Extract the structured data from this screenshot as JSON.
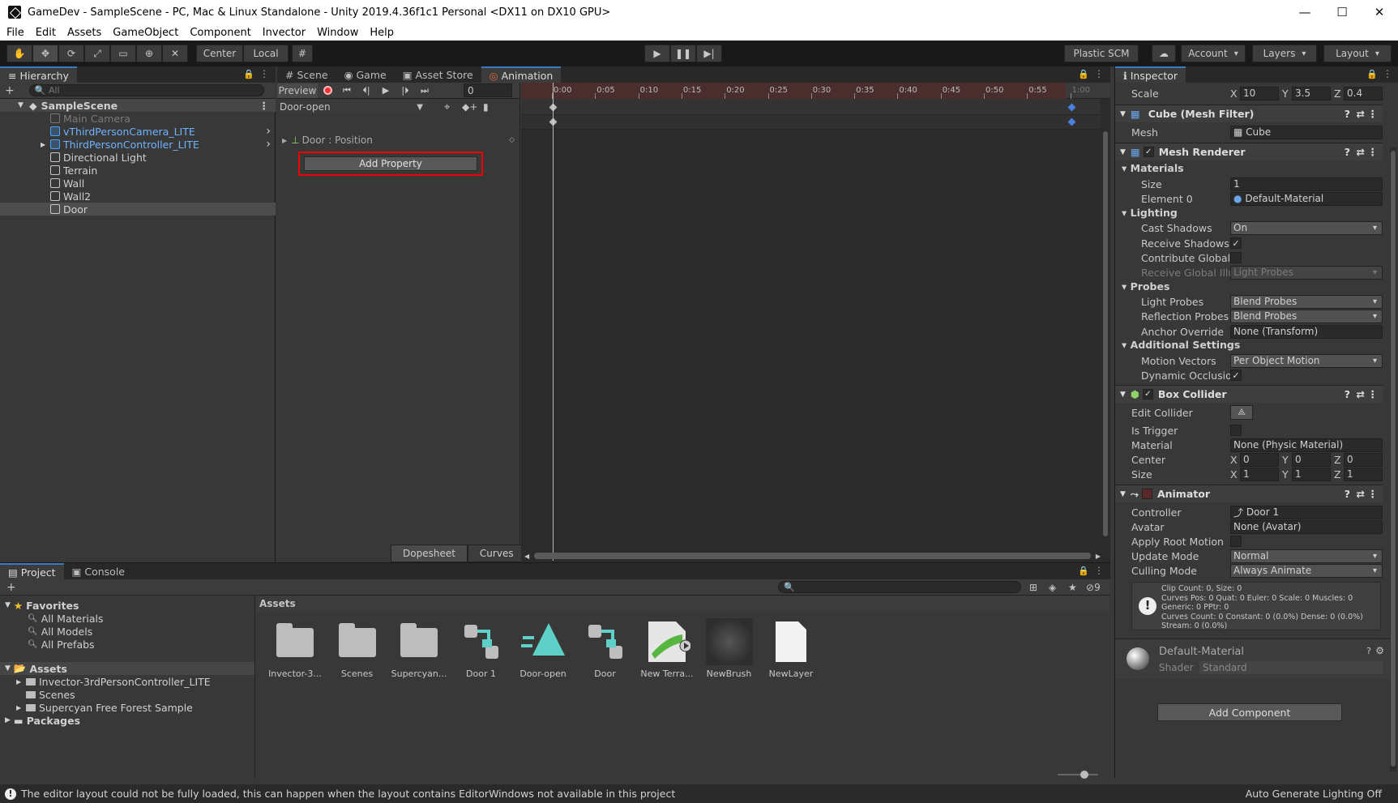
{
  "window": {
    "title": "GameDev - SampleScene - PC, Mac & Linux Standalone - Unity 2019.4.36f1c1 Personal <DX11 on DX10 GPU>",
    "minimize": "—",
    "maximize": "☐",
    "close": "✕"
  },
  "menu": [
    "File",
    "Edit",
    "Assets",
    "GameObject",
    "Component",
    "Invector",
    "Window",
    "Help"
  ],
  "toolbar": {
    "tools": [
      "✋",
      "✥",
      "⟳",
      "⤢",
      "▭",
      "⊕",
      "✕"
    ],
    "pivot": "Center",
    "space": "Local",
    "grid": "#",
    "play": "▶",
    "pause": "❚❚",
    "step": "▶|",
    "plastic": "Plastic SCM",
    "cloud": "☁",
    "account": "Account",
    "layers": "Layers",
    "layout": "Layout"
  },
  "hierarchy": {
    "tab": "Hierarchy",
    "add": "+",
    "search_placeholder": "All",
    "scene": "SampleScene",
    "items": [
      {
        "label": "Main Camera",
        "style": "disabled"
      },
      {
        "label": "vThirdPersonCamera_LITE",
        "style": "prefab"
      },
      {
        "label": "ThirdPersonController_LITE",
        "style": "prefab"
      },
      {
        "label": "Directional Light",
        "style": "normal"
      },
      {
        "label": "Terrain",
        "style": "normal"
      },
      {
        "label": "Wall",
        "style": "normal"
      },
      {
        "label": "Wall2",
        "style": "normal"
      },
      {
        "label": "Door",
        "style": "selected"
      }
    ]
  },
  "center_tabs": [
    "Scene",
    "Game",
    "Asset Store",
    "Animation"
  ],
  "animation": {
    "preview": "Preview",
    "frame": "0",
    "clip": "Door-open",
    "property": "Door : Position",
    "add_property": "Add Property",
    "ticks": [
      "0:00",
      "0:05",
      "0:10",
      "0:15",
      "0:20",
      "0:25",
      "0:30",
      "0:35",
      "0:40",
      "0:45",
      "0:50",
      "0:55",
      "1:00"
    ],
    "dopesheet": "Dopesheet",
    "curves": "Curves"
  },
  "inspector": {
    "tab": "Inspector",
    "scale": {
      "label": "Scale",
      "x": "10",
      "y": "3.5",
      "z": "0.4"
    },
    "mesh_filter": {
      "title": "Cube (Mesh Filter)",
      "mesh_label": "Mesh",
      "mesh_value": "Cube"
    },
    "mesh_renderer": {
      "title": "Mesh Renderer",
      "materials": "Materials",
      "size_label": "Size",
      "size": "1",
      "element0_label": "Element 0",
      "element0": "Default-Material",
      "lighting": "Lighting",
      "cast_shadows_label": "Cast Shadows",
      "cast_shadows": "On",
      "receive_shadows_label": "Receive Shadows",
      "contribute_gi_label": "Contribute Global I",
      "receive_gi_label": "Receive Global Illu",
      "receive_gi": "Light Probes",
      "probes": "Probes",
      "light_probes_label": "Light Probes",
      "light_probes": "Blend Probes",
      "reflection_probes_label": "Reflection Probes",
      "reflection_probes": "Blend Probes",
      "anchor_label": "Anchor Override",
      "anchor": "None (Transform)",
      "additional": "Additional Settings",
      "motion_label": "Motion Vectors",
      "motion": "Per Object Motion",
      "dynamic_label": "Dynamic Occlusior"
    },
    "box_collider": {
      "title": "Box Collider",
      "edit_label": "Edit Collider",
      "trigger_label": "Is Trigger",
      "material_label": "Material",
      "material": "None (Physic Material)",
      "center_label": "Center",
      "center": {
        "x": "0",
        "y": "0",
        "z": "0"
      },
      "size_label": "Size",
      "size": {
        "x": "1",
        "y": "1",
        "z": "1"
      }
    },
    "animator": {
      "title": "Animator",
      "controller_label": "Controller",
      "controller": "Door 1",
      "avatar_label": "Avatar",
      "avatar": "None (Avatar)",
      "root_motion_label": "Apply Root Motion",
      "update_label": "Update Mode",
      "update": "Normal",
      "culling_label": "Culling Mode",
      "culling": "Always Animate",
      "info": [
        "Clip Count: 0, Size: 0",
        "Curves Pos: 0 Quat: 0 Euler: 0 Scale: 0 Muscles: 0",
        "Generic: 0 PPtr: 0",
        "Curves Count: 0 Constant: 0 (0.0%) Dense: 0 (0.0%)",
        "Stream: 0 (0.0%)"
      ]
    },
    "material": {
      "name": "Default-Material",
      "shader_label": "Shader",
      "shader": "Standard"
    },
    "add_component": "Add Component"
  },
  "project": {
    "tabs": [
      "Project",
      "Console"
    ],
    "add": "+",
    "hidden_count": "9",
    "favorites": "Favorites",
    "fav_items": [
      "All Materials",
      "All Models",
      "All Prefabs"
    ],
    "assets_root": "Assets",
    "asset_folders": [
      "Invector-3rdPersonController_LITE",
      "Scenes",
      "Supercyan Free Forest Sample"
    ],
    "packages": "Packages",
    "breadcrumb": "Assets",
    "grid": [
      {
        "label": "Invector-3...",
        "kind": "folder"
      },
      {
        "label": "Scenes",
        "kind": "folder"
      },
      {
        "label": "Supercyan...",
        "kind": "folder"
      },
      {
        "label": "Door 1",
        "kind": "controller"
      },
      {
        "label": "Door-open",
        "kind": "clip"
      },
      {
        "label": "Door",
        "kind": "controller"
      },
      {
        "label": "New Terra...",
        "kind": "terrain"
      },
      {
        "label": "NewBrush",
        "kind": "brush"
      },
      {
        "label": "NewLayer",
        "kind": "file"
      }
    ]
  },
  "status": {
    "message": "The editor layout could not be fully loaded, this can happen when the layout contains EditorWindows not available in this project",
    "right": "Auto Generate Lighting Off"
  }
}
